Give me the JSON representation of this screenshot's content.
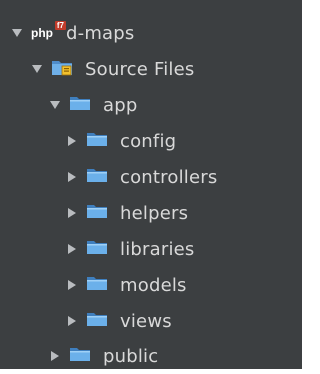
{
  "tree": {
    "project": {
      "php_badge": "php",
      "php_badge_sup": "f7",
      "name": "d-maps",
      "expanded": true
    },
    "source_files": {
      "label": "Source Files",
      "expanded": true
    },
    "app": {
      "label": "app",
      "expanded": true
    },
    "app_children": [
      {
        "label": "config",
        "expanded": false
      },
      {
        "label": "controllers",
        "expanded": false
      },
      {
        "label": "helpers",
        "expanded": false
      },
      {
        "label": "libraries",
        "expanded": false
      },
      {
        "label": "models",
        "expanded": false
      },
      {
        "label": "views",
        "expanded": false
      }
    ],
    "public": {
      "label": "public",
      "expanded": false
    }
  },
  "icons": {
    "expanded_arrow": "expanded-arrow-icon",
    "collapsed_arrow": "collapsed-arrow-icon",
    "folder": "folder-icon",
    "source_folder": "source-folder-icon"
  },
  "colors": {
    "background": "#3c3f41",
    "text": "#d9d9d9",
    "folder": "#5e9ed6",
    "source_accent": "#e8b931"
  }
}
